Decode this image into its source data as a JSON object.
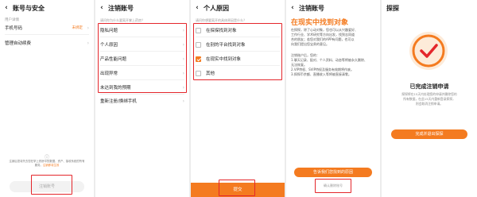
{
  "s1": {
    "title": "账号与安全",
    "section": "用户详情",
    "phone_label": "手机号码",
    "phone_value": "未绑定",
    "autopay_label": "管理自动续费",
    "notice_line1": "注销后您将失去您在掌上药房中的数据、资产、接收系统的所有",
    "notice_line2": "服务。",
    "notice_link": "注销即将生效",
    "cancel_button": "注销账号"
  },
  "s2": {
    "title": "注销账号",
    "prompt": "请问你为什么要离开掌上药房？",
    "reasons": [
      "隐私问题",
      "个人原因",
      "产品性能问题",
      "出现异常",
      "未达到我的预期"
    ],
    "extra": "重新注册/换绑手机"
  },
  "s3": {
    "title": "个人原因",
    "prompt": "请问你想要离开的具体原因是什么？",
    "options": [
      {
        "label": "在探探找到对象",
        "checked": false
      },
      {
        "label": "在别的平台找到对象",
        "checked": false
      },
      {
        "label": "在现实中找到对象",
        "checked": true
      },
      {
        "label": "其他",
        "checked": false
      }
    ],
    "submit": "提交"
  },
  "s4": {
    "title": "注销账号",
    "heading": "在现实中找到对象",
    "para1_l1": "在探探，除了心动对象，您也可以从兴趣爱好、",
    "para1_l2": "工作行业、学术研究等方向出发，找到志同道",
    "para1_l3": "合的朋友；若您对我们的APP有问题，也可以",
    "para1_l4": "向我们提出您宝贵的意见。",
    "sub_heading": "注销账户后，您的：",
    "item1_l1": "1.聊天记录、配对、个人资料、动态等将被永久删除、",
    "item1_l2": "无法恢复。",
    "item2": "2.VIP特权、SVIP特权及服务有效期将作废。",
    "item3": "3.探探币余额、直播收入等将被直接清零。",
    "keep_button": "告诉我们您找到的原因",
    "confirm_link": "确认删除账号"
  },
  "s5": {
    "title": "探探",
    "heading": "已完成注销申请",
    "desc_l1": "探探将在15天内处理您的申请并删除您的",
    "desc_l2": "所有数据，在此15天内重新登录探探，",
    "desc_l3": "则会取消注销申请。",
    "button": "完成并退出探探"
  },
  "colors": {
    "accent": "#f47b20",
    "highlight_box": "#e4262b"
  }
}
